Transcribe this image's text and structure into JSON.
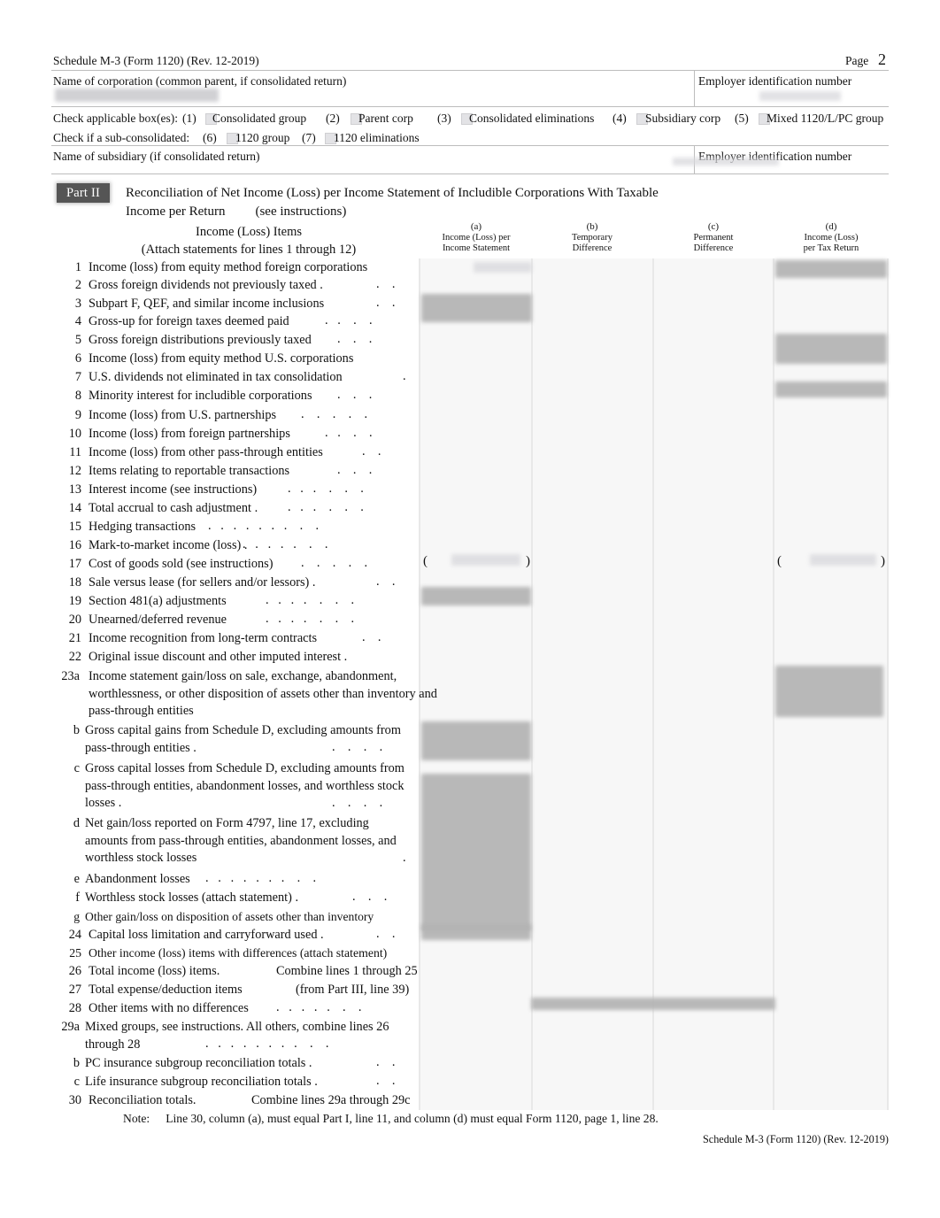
{
  "document": {
    "form_id": "Schedule M-3 (Form 1120) (Rev. 12-2019)",
    "page_word": "Page",
    "page_number": "2",
    "footer_id": "Schedule M-3 (Form 1120) (Rev. 12-2019)"
  },
  "header": {
    "name_of_corporation_label": "Name of corporation (common parent, if consolidated return)",
    "employer_id_label_1": "Employer identification number",
    "name_of_subsidiary_label": "Name of subsidiary (if consolidated return)",
    "employer_id_label_2": "Employer identification number",
    "check_applicable_label": "Check applicable box(es):",
    "check_sub_consolidated_label": "Check if a sub-consolidated:",
    "checkboxes": [
      {
        "number": "(1)",
        "label": "Consolidated group"
      },
      {
        "number": "(2)",
        "label": "Parent corp"
      },
      {
        "number": "(3)",
        "label": "Consolidated eliminations"
      },
      {
        "number": "(4)",
        "label": "Subsidiary corp"
      },
      {
        "number": "(5)",
        "label": "Mixed 1120/L/PC group"
      }
    ],
    "sub_checkboxes": [
      {
        "number": "(6)",
        "label": "1120 group"
      },
      {
        "number": "(7)",
        "label": "1120 eliminations"
      }
    ]
  },
  "part": {
    "tag": "Part II",
    "title_line1": "Reconciliation of Net Income (Loss) per Income Statement of Includible Corporations With Taxable",
    "title_line2": "Income per Return",
    "see_instructions": "(see instructions)"
  },
  "table": {
    "items_header_line1": "Income (Loss) Items",
    "items_header_line2": "(Attach statements for lines 1 through 12)",
    "columns": [
      {
        "letter": "(a)",
        "line1": "Income (Loss) per",
        "line2": "Income Statement"
      },
      {
        "letter": "(b)",
        "line1": "Temporary",
        "line2": "Difference"
      },
      {
        "letter": "(c)",
        "line1": "Permanent",
        "line2": "Difference"
      },
      {
        "letter": "(d)",
        "line1": "Income (Loss)",
        "line2": "per  Tax Return"
      }
    ],
    "rows": [
      {
        "num": "1",
        "text": "Income (loss) from equity method foreign corporations"
      },
      {
        "num": "2",
        "text": "Gross foreign dividends not previously taxed ."
      },
      {
        "num": "3",
        "text": "Subpart F, QEF, and similar income inclusions"
      },
      {
        "num": "4",
        "text": "Gross-up for foreign taxes deemed paid"
      },
      {
        "num": "5",
        "text": "Gross foreign distributions previously taxed"
      },
      {
        "num": "6",
        "text": "Income (loss) from equity method U.S. corporations"
      },
      {
        "num": "7",
        "text": "U.S. dividends not eliminated in tax consolidation"
      },
      {
        "num": "8",
        "text": "Minority interest for includible corporations"
      },
      {
        "num": "9",
        "text": "Income (loss) from U.S. partnerships"
      },
      {
        "num": "10",
        "text": "Income (loss) from foreign partnerships"
      },
      {
        "num": "11",
        "text": "Income (loss) from other pass-through entities"
      },
      {
        "num": "12",
        "text": "Items relating to reportable transactions"
      },
      {
        "num": "13",
        "text": "Interest income (see instructions)"
      },
      {
        "num": "14",
        "text": "Total accrual to cash adjustment ."
      },
      {
        "num": "15",
        "text": "Hedging transactions"
      },
      {
        "num": "16",
        "text": "Mark-to-market income (loss) ."
      },
      {
        "num": "17",
        "text": "Cost of goods sold (see instructions)"
      },
      {
        "num": "18",
        "text": "Sale versus lease (for sellers and/or lessors) ."
      },
      {
        "num": "19",
        "text": "Section 481(a) adjustments"
      },
      {
        "num": "20",
        "text": "Unearned/deferred revenue"
      },
      {
        "num": "21",
        "text": "Income recognition from long-term contracts"
      },
      {
        "num": "22",
        "text": "Original issue discount and other imputed interest ."
      },
      {
        "num": "23a",
        "text": "Income statement gain/loss on sale, exchange, abandonment, worthlessness, or other disposition of assets other than inventory and pass-through entities"
      },
      {
        "num": "b",
        "text": "Gross capital gains from Schedule D, excluding amounts from pass-through entities ."
      },
      {
        "num": "c",
        "text": "Gross capital losses from Schedule D, excluding amounts from pass-through entities, abandonment losses, and worthless stock losses ."
      },
      {
        "num": "d",
        "text": "Net gain/loss reported on Form 4797, line 17, excluding amounts from pass-through entities, abandonment losses, and worthless stock losses"
      },
      {
        "num": "e",
        "text": "Abandonment losses"
      },
      {
        "num": "f",
        "text": "Worthless stock losses (attach statement) ."
      },
      {
        "num": "g",
        "text": "Other gain/loss on disposition of assets other than inventory"
      },
      {
        "num": "24",
        "text": "Capital loss limitation and carryforward used ."
      },
      {
        "num": "25",
        "text": "Other income (loss) items with differences (attach statement)"
      },
      {
        "num": "26",
        "text": "Total income (loss) items.",
        "text2": "Combine lines 1 through 25"
      },
      {
        "num": "27",
        "text": "Total expense/deduction items",
        "text2": "(from Part III, line 39)"
      },
      {
        "num": "28",
        "text": "Other items with no differences"
      },
      {
        "num": "29a",
        "text": "Mixed groups, see instructions. All others, combine lines 26 through 28"
      },
      {
        "num": "b",
        "text": "PC insurance subgroup reconciliation totals ."
      },
      {
        "num": "c",
        "text": "Life insurance subgroup reconciliation totals ."
      },
      {
        "num": "30",
        "text": "Reconciliation totals.",
        "text2": "Combine lines 29a through 29c"
      }
    ]
  },
  "note": {
    "label": "Note:",
    "text": "Line 30, column (a), must equal Part I, line 11, and column (d) must equal Form 1120, page 1, line 28."
  },
  "colors": {
    "part_tag_bg": "#555555",
    "redaction": "#c9c9cd",
    "grid_bg": "#f7f7f7",
    "rule": "#bdbdbd"
  }
}
